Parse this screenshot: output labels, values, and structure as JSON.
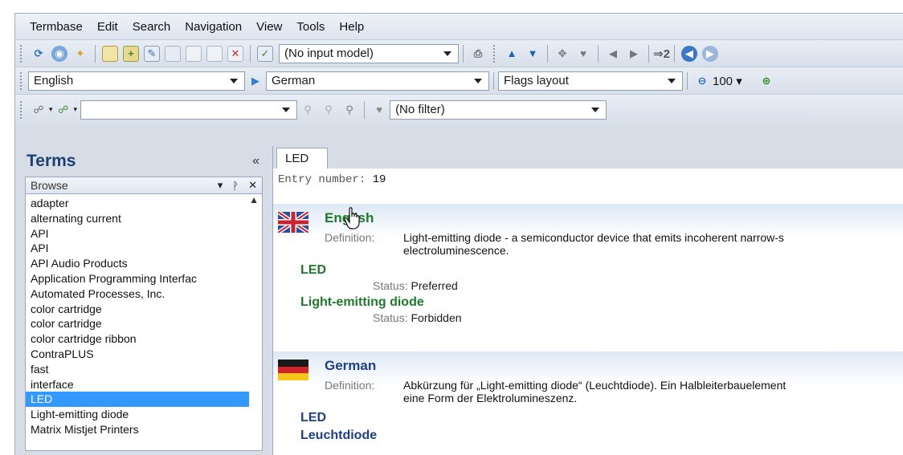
{
  "menu": [
    "Termbase",
    "Edit",
    "Search",
    "Navigation",
    "View",
    "Tools",
    "Help"
  ],
  "toolbar1": {
    "input_model": "(No input model)",
    "nav_label": "2"
  },
  "toolbar2": {
    "source_lang": "English",
    "target_lang": "German",
    "layout": "Flags layout",
    "zoom": "100"
  },
  "toolbar3": {
    "search_value": "",
    "filter": "(No filter)"
  },
  "terms_panel": {
    "title": "Terms",
    "collapse_glyph": "«",
    "browse_label": "Browse",
    "items": [
      "adapter",
      "alternating current",
      "API",
      "API",
      "API Audio Products",
      "Application  Programming Interfac",
      "Automated Processes, Inc.",
      "color cartridge",
      "color cartridge",
      "color cartridge ribbon",
      "ContraPLUS",
      "fast",
      "interface",
      "LED",
      "Light-emitting diode",
      "Matrix Mistjet Printers"
    ],
    "selected_index": 13
  },
  "entry": {
    "tab_label": "LED",
    "entry_number_label": "Entry number:",
    "entry_number": "19",
    "english": {
      "language": "English",
      "definition_label": "Definition:",
      "definition": "Light-emitting diode - a semiconductor device that emits incoherent narrow-s\nelectroluminescence.",
      "terms": [
        {
          "term": "LED",
          "status_label": "Status:",
          "status": "Preferred"
        },
        {
          "term": "Light-emitting diode",
          "status_label": "Status:",
          "status": "Forbidden"
        }
      ]
    },
    "german": {
      "language": "German",
      "definition_label": "Definition:",
      "definition": "Abkürzung für „Light-emitting diode“ (Leuchtdiode). Ein Halbleiterbauelement\neine Form der Elektrolumineszenz.",
      "terms": [
        "LED",
        "Leuchtdiode"
      ]
    }
  }
}
